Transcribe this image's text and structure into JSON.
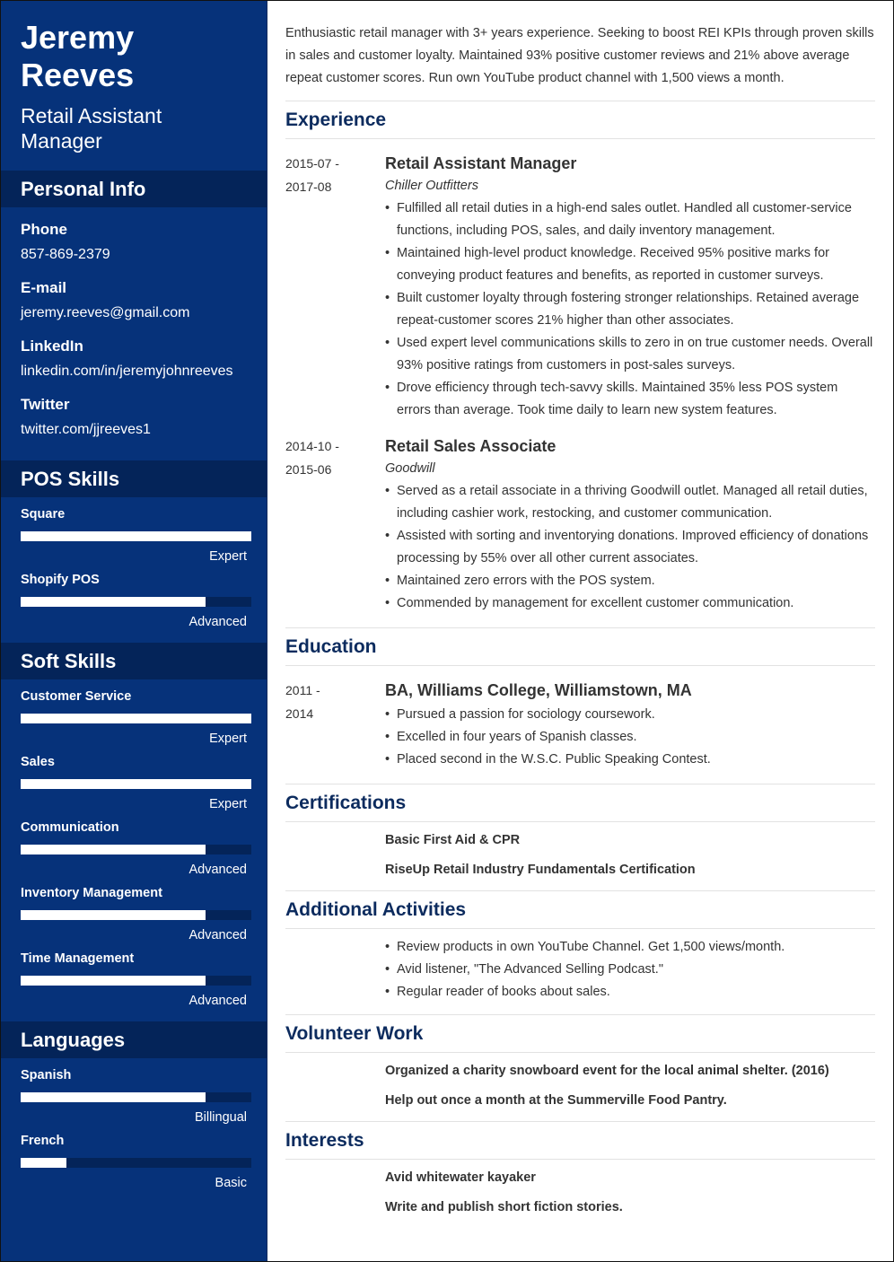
{
  "colors": {
    "sidebar_bg": "#06327a",
    "sidebar_header_bg": "#042459",
    "section_title": "#0c2b5e"
  },
  "header": {
    "first_name": "Jeremy",
    "last_name": "Reeves",
    "title": "Retail Assistant Manager"
  },
  "personal_info": {
    "heading": "Personal Info",
    "items": [
      {
        "label": "Phone",
        "value": "857-869-2379"
      },
      {
        "label": "E-mail",
        "value": "jeremy.reeves@gmail.com"
      },
      {
        "label": "LinkedIn",
        "value": "linkedin.com/in/jeremyjohnreeves"
      },
      {
        "label": "Twitter",
        "value": "twitter.com/jjreeves1"
      }
    ]
  },
  "pos_skills": {
    "heading": "POS Skills",
    "items": [
      {
        "name": "Square",
        "level": "Expert",
        "fill": 1.0
      },
      {
        "name": "Shopify POS",
        "level": "Advanced",
        "fill": 0.8
      }
    ]
  },
  "soft_skills": {
    "heading": "Soft Skills",
    "items": [
      {
        "name": "Customer Service",
        "level": "Expert",
        "fill": 1.0
      },
      {
        "name": "Sales",
        "level": "Expert",
        "fill": 1.0
      },
      {
        "name": "Communication",
        "level": "Advanced",
        "fill": 0.8
      },
      {
        "name": "Inventory Management",
        "level": "Advanced",
        "fill": 0.8
      },
      {
        "name": "Time Management",
        "level": "Advanced",
        "fill": 0.8
      }
    ]
  },
  "languages": {
    "heading": "Languages",
    "items": [
      {
        "name": "Spanish",
        "level": "Billingual",
        "fill": 0.8
      },
      {
        "name": "French",
        "level": "Basic",
        "fill": 0.2
      }
    ]
  },
  "summary": "Enthusiastic retail manager with 3+ years experience. Seeking to boost REI KPIs through proven skills in sales and customer loyalty. Maintained 93% positive customer reviews and 21% above average repeat customer scores. Run own YouTube product channel with 1,500 views a month.",
  "experience": {
    "heading": "Experience",
    "entries": [
      {
        "date_start": "2015-07 -",
        "date_end": "2017-08",
        "title": "Retail Assistant Manager",
        "company": "Chiller Outfitters",
        "bullets": [
          "Fulfilled all retail duties in a high-end sales outlet. Handled all customer-service functions, including POS, sales, and daily inventory management.",
          "Maintained high-level product knowledge. Received 95% positive marks for conveying product features and benefits, as reported in customer surveys.",
          "Built customer loyalty through fostering stronger relationships. Retained average repeat-customer scores 21% higher than other associates.",
          "Used expert level communications skills to zero in on true customer needs. Overall 93% positive ratings from customers in post-sales surveys.",
          "Drove efficiency through tech-savvy skills. Maintained 35% less POS system errors than average. Took time daily to learn new system features."
        ]
      },
      {
        "date_start": "2014-10 -",
        "date_end": "2015-06",
        "title": "Retail Sales Associate",
        "company": "Goodwill",
        "bullets": [
          "Served as a retail associate in a thriving Goodwill outlet. Managed all retail duties, including cashier work, restocking, and customer communication.",
          "Assisted with sorting and inventorying donations. Improved efficiency of donations processing by 55% over all other current associates.",
          "Maintained zero errors with the POS system.",
          "Commended by management for excellent customer communication."
        ]
      }
    ]
  },
  "education": {
    "heading": "Education",
    "entries": [
      {
        "date_start": "2011 -",
        "date_end": "2014",
        "title": "BA, Williams College, Williamstown, MA",
        "bullets": [
          "Pursued a passion for sociology coursework.",
          "Excelled in four years of Spanish classes.",
          "Placed second in the W.S.C. Public Speaking Contest."
        ]
      }
    ]
  },
  "certifications": {
    "heading": "Certifications",
    "items": [
      "Basic First Aid & CPR",
      "RiseUp Retail Industry Fundamentals Certification"
    ]
  },
  "activities": {
    "heading": "Additional Activities",
    "items": [
      "Review products in own YouTube Channel. Get 1,500 views/month.",
      "Avid listener, \"The Advanced Selling Podcast.\"",
      "Regular reader of books about sales."
    ]
  },
  "volunteer": {
    "heading": "Volunteer Work",
    "items": [
      "Organized a charity snowboard event for the local animal shelter. (2016)",
      "Help out once a month at the Summerville Food Pantry."
    ]
  },
  "interests": {
    "heading": "Interests",
    "items": [
      "Avid whitewater kayaker",
      "Write and publish short fiction stories."
    ]
  }
}
